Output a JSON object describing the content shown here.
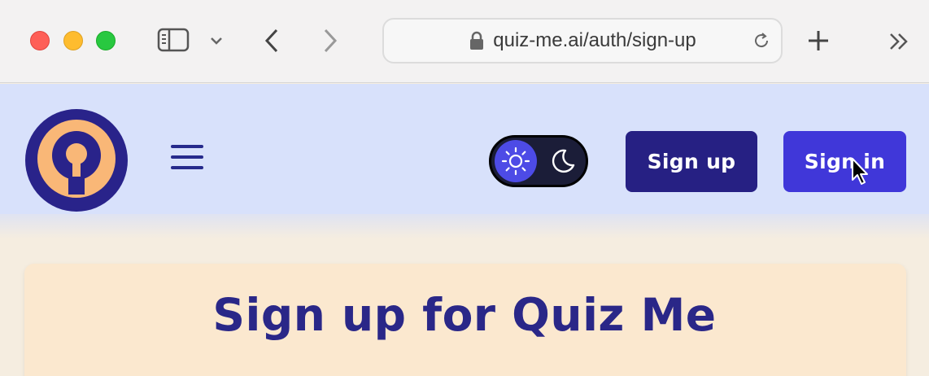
{
  "browser": {
    "url": "quiz-me.ai/auth/sign-up"
  },
  "header": {
    "signup_label": "Sign up",
    "signin_label": "Sign in",
    "theme": "light"
  },
  "card": {
    "title": "Sign up for Quiz Me"
  },
  "colors": {
    "primary_dark": "#262083",
    "primary": "#4037d9",
    "header_bg": "#d8e1fb",
    "card_bg": "#fbe8cf",
    "logo_orange": "#f9b777"
  }
}
